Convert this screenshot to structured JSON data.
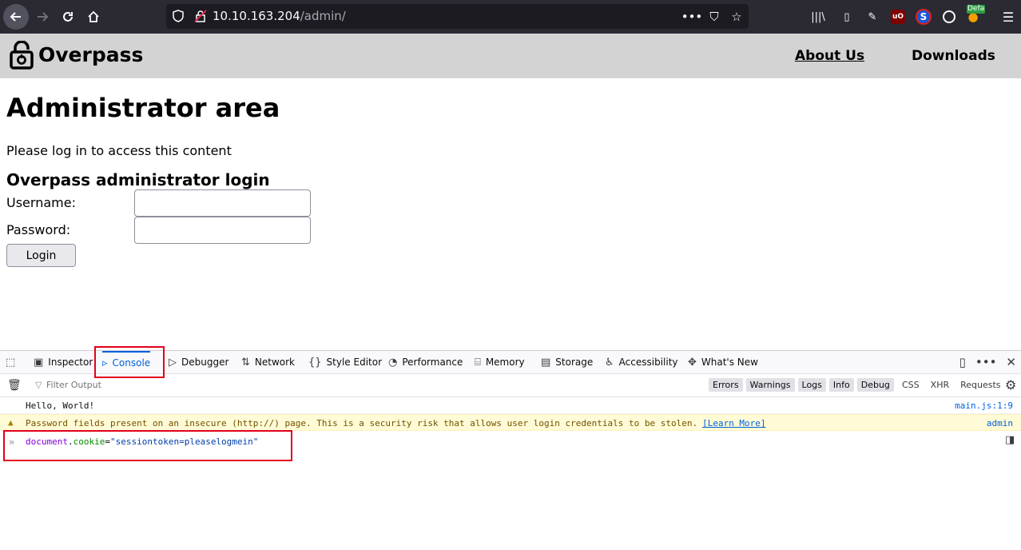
{
  "browser": {
    "url_host": "10.10.163.204",
    "url_path": "/admin/",
    "profile_badge": "Defa"
  },
  "site": {
    "brand": "Overpass",
    "nav": {
      "about": "About Us",
      "downloads": "Downloads"
    }
  },
  "page": {
    "title": "Administrator area",
    "intro": "Please log in to access this content",
    "form_title": "Overpass administrator login",
    "username_label": "Username:",
    "password_label": "Password:",
    "login_button": "Login"
  },
  "devtools": {
    "tabs": [
      "Inspector",
      "Console",
      "Debugger",
      "Network",
      "Style Editor",
      "Performance",
      "Memory",
      "Storage",
      "Accessibility",
      "What's New"
    ],
    "active_tab": "Console",
    "filter_placeholder": "Filter Output",
    "levels": [
      "Errors",
      "Warnings",
      "Logs",
      "Info",
      "Debug"
    ],
    "net_filters": [
      "CSS",
      "XHR",
      "Requests"
    ],
    "messages": {
      "log_text": "Hello, World!",
      "log_source": "main.js:1:9",
      "warning_text": "Password fields present on an insecure (http://) page. This is a security risk that allows user login credentials to be stolen.",
      "warning_link": "[Learn More]",
      "warning_source": "admin"
    },
    "input": {
      "object": "document",
      "property": "cookie",
      "operator": "=",
      "value": "\"sessiontoken=pleaselogmein\""
    }
  },
  "colors": {
    "highlight": "#e3001b",
    "devtools_accent": "#0060df",
    "header_bg": "#d3d3d3",
    "toolbar_bg": "#2b2a33"
  }
}
